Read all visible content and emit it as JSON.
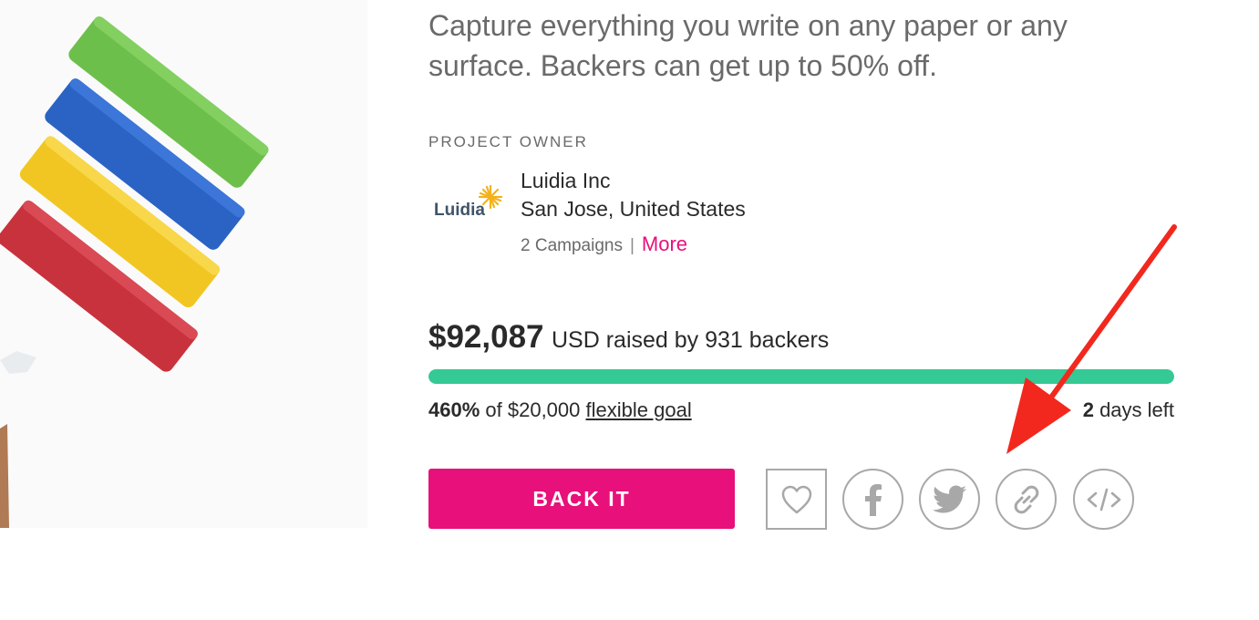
{
  "campaign": {
    "tagline": "Capture everything you write on any paper or any surface. Backers can get up to 50% off."
  },
  "owner": {
    "heading": "PROJECT OWNER",
    "logo_text": "Luidia",
    "name": "Luidia Inc",
    "location": "San Jose, United States",
    "campaigns": "2 Campaigns",
    "separator": "|",
    "more_label": "More"
  },
  "funding": {
    "amount": "$92,087",
    "raised_text": "USD raised by 931 backers",
    "progress_percent_shown": 100,
    "percent": "460%",
    "goal_text": "of $20,000",
    "goal_link": "flexible goal",
    "days_count": "2",
    "days_text": "days left"
  },
  "actions": {
    "back_label": "BACK IT",
    "favorite_icon": "heart-icon",
    "facebook_icon": "facebook-icon",
    "twitter_icon": "twitter-icon",
    "link_icon": "link-icon",
    "embed_icon": "embed-code-icon"
  },
  "colors": {
    "accent": "#e8107a",
    "progress": "#35c995",
    "annotation_arrow": "#f2281e",
    "icon_gray": "#a8a8a8"
  }
}
